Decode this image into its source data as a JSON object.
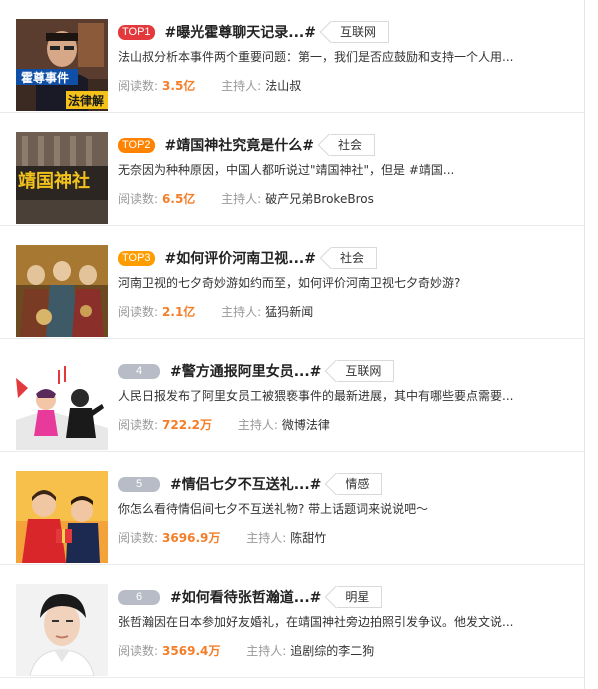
{
  "labels": {
    "reads": "阅读数:",
    "host": "主持人:"
  },
  "items": [
    {
      "rank": "TOP1",
      "topic": "#曝光霍尊聊天记录...#",
      "tag": "互联网",
      "desc": "法山叔分析本事件两个重要问题：第一，我们是否应鼓励和支持一个人用...",
      "reads": "3.5亿",
      "host": "法山叔",
      "thumb_text": [
        "霍尊事件",
        "法律解"
      ]
    },
    {
      "rank": "TOP2",
      "topic": "#靖国神社究竟是什么#",
      "tag": "社会",
      "desc": "无奈因为种种原因，中国人都听说过\"靖国神社\"，但是 #靖国...",
      "reads": "6.5亿",
      "host": "破产兄弟BrokeBros",
      "thumb_text": [
        "靖国神社"
      ]
    },
    {
      "rank": "TOP3",
      "topic": "#如何评价河南卫视...#",
      "tag": "社会",
      "desc": "河南卫视的七夕奇妙游如约而至，如何评价河南卫视七夕奇妙游?",
      "reads": "2.1亿",
      "host": "猛犸新闻"
    },
    {
      "rank": "4",
      "topic": "#警方通报阿里女员...#",
      "tag": "互联网",
      "desc": "人民日报发布了阿里女员工被猥亵事件的最新进展，其中有哪些要点需要...",
      "reads": "722.2万",
      "host": "微博法律"
    },
    {
      "rank": "5",
      "topic": "#情侣七夕不互送礼...#",
      "tag": "情感",
      "desc": "你怎么看待情侣间七夕不互送礼物? 带上话题词来说说吧～",
      "reads": "3696.9万",
      "host": "陈甜竹"
    },
    {
      "rank": "6",
      "topic": "#如何看待张哲瀚道...#",
      "tag": "明星",
      "desc": "张哲瀚因在日本参加好友婚礼，在靖国神社旁边拍照引发争议。他发文说...",
      "reads": "3569.4万",
      "host": "追剧综的李二狗"
    }
  ]
}
